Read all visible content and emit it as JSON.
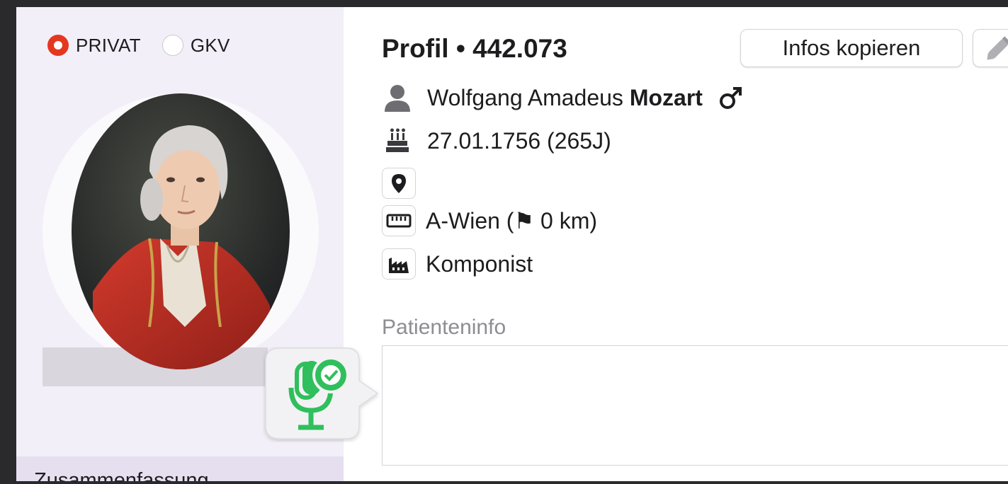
{
  "insurance": {
    "options": [
      {
        "label": "PRIVAT",
        "selected": true
      },
      {
        "label": "GKV",
        "selected": false
      }
    ]
  },
  "profile": {
    "title": "Profil • 442.073",
    "copy_button": "Infos kopieren",
    "edit_icon": "pencil-icon",
    "name_first": "Wolfgang Amadeus",
    "name_last": "Mozart",
    "gender_icon": "male-icon",
    "birth": "27.01.1756 (265J)",
    "distance": "A-Wien (⚑ 0 km)",
    "occupation": "Komponist"
  },
  "patient_info": {
    "label": "Patienteninfo",
    "value": ""
  },
  "sidebar": {
    "summary_tab": "Zusammenfassung"
  },
  "colors": {
    "accent_red": "#e5371f",
    "mic_green": "#2fbf5c",
    "sidebar_bg": "#f3eff9"
  }
}
